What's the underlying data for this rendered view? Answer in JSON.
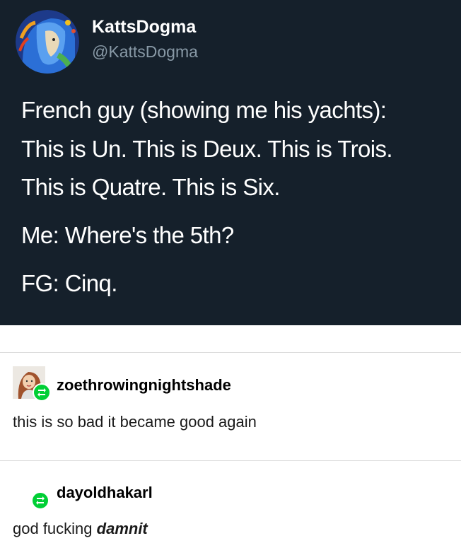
{
  "tweet": {
    "display_name": "KattsDogma",
    "handle": "@KattsDogma",
    "lines": [
      "French guy (showing me his yachts):",
      "This is Un. This is Deux. This is Trois.",
      "This is Quatre. This is Six.",
      "Me: Where's the 5th?",
      "FG: Cinq."
    ]
  },
  "reblogs": [
    {
      "username": "zoethrowingnightshade",
      "text": "this is so bad it became good again",
      "has_avatar": true
    },
    {
      "username": "dayoldhakarl",
      "text_plain": "god fucking ",
      "text_emphasis": "damnit",
      "has_avatar": false
    }
  ],
  "colors": {
    "tweet_background": "#15202b",
    "tweet_handle": "#8899a6",
    "reblog_badge": "#00cf35",
    "divider": "#dcdcdc"
  },
  "icons": {
    "reblog_badge": "reblog-icon",
    "tweet_avatar": "illustrated-face-avatar",
    "reblog_avatar": "illustrated-woman-avatar"
  }
}
